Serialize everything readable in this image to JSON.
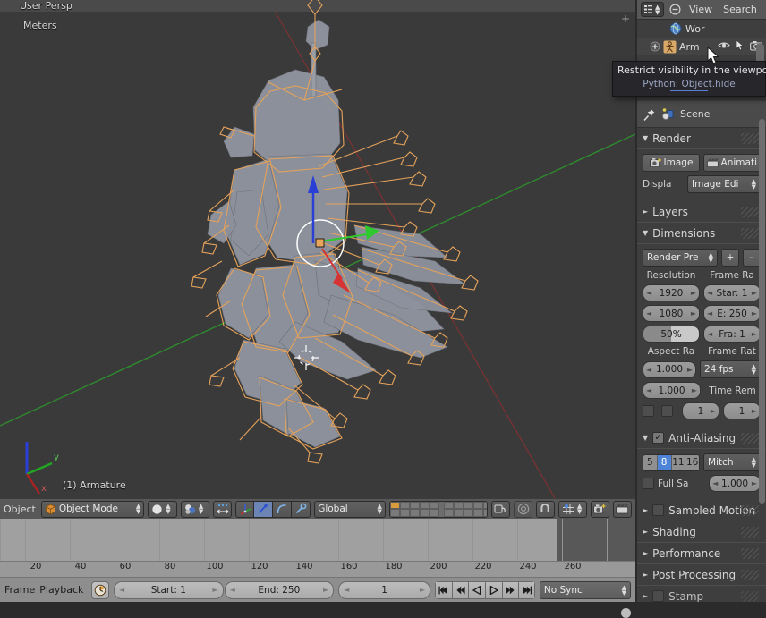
{
  "viewport": {
    "perspective_label": "User Persp",
    "units_label": "Meters",
    "object_label": "(1) Armature",
    "gizmo_axes": [
      "x",
      "y",
      "z"
    ]
  },
  "outliner": {
    "header": {
      "editor_type_icon": "outliner-icon",
      "display_mode_icon": "minus-circle-icon",
      "menus": [
        "View",
        "Search"
      ]
    },
    "rows": [
      {
        "label": "Wor",
        "icon": "world-globe-icon",
        "expander": ""
      },
      {
        "label": "Arm",
        "icon": "armature-icon",
        "expander": "+",
        "restrict_icons": [
          "eye-icon",
          "cursor-arrow-icon",
          "camera-icon"
        ]
      }
    ]
  },
  "tooltip": {
    "title": "Restrict visibility in the viewport",
    "python": "Python: Object.hide"
  },
  "properties": {
    "header": {
      "pin_icon": "pin-icon",
      "scene_icon": "scene-icon",
      "scene_label": "Scene"
    },
    "panels": [
      {
        "id": "render",
        "title": "Render",
        "expanded": true,
        "buttons": [
          {
            "label": "Image",
            "icon": "render-image-icon"
          },
          {
            "label": "Animati",
            "icon": "render-animation-icon"
          }
        ],
        "display_label": "Displa",
        "display_value": "Image Edi"
      },
      {
        "id": "layers",
        "title": "Layers",
        "expanded": false
      },
      {
        "id": "dimensions",
        "title": "Dimensions",
        "expanded": true,
        "preset_value": "Render Pre",
        "preset_add": "+",
        "preset_remove": "–",
        "resolution_header": "Resolution",
        "resolution_x": "1920",
        "resolution_y": "1080",
        "resolution_pct": "50%",
        "frame_range_header": "Frame Ra",
        "frame_start": "Star: 1",
        "frame_end": "E: 250",
        "frame_step": "Fra: 1",
        "aspect_header": "Aspect Ra",
        "aspect_x": "1.000",
        "aspect_y": "1.000",
        "framerate_header": "Frame Rat",
        "framerate_value": "24 fps",
        "time_remap_header": "Time Rem",
        "time_remap_old": "1",
        "time_remap_new": "1"
      },
      {
        "id": "anti-aliasing",
        "title": "Anti-Aliasing",
        "expanded": true,
        "checked": true,
        "samples": [
          "5",
          "8",
          "11",
          "16"
        ],
        "selected_sample": "8",
        "filter_value": "Mitch",
        "full_sample_label": "Full Sa",
        "full_sample_checked": false,
        "filter_size": "1.000"
      },
      {
        "id": "sampled-motion-blur",
        "title": "Sampled Motion",
        "expanded": false,
        "has_checkbox": true
      },
      {
        "id": "shading",
        "title": "Shading",
        "expanded": false
      },
      {
        "id": "performance",
        "title": "Performance",
        "expanded": false
      },
      {
        "id": "post-processing",
        "title": "Post Processing",
        "expanded": false
      },
      {
        "id": "stamp",
        "title": "Stamp",
        "expanded": false,
        "has_checkbox": true
      }
    ]
  },
  "viewport_toolbar": {
    "menu_label": "Object",
    "mode_value": "Object Mode",
    "mode_icon": "object-mode-cube-icon",
    "shading_icon": "solid-shading-sphere-icon",
    "render_engine_icon": "material-mode-icon",
    "expand_icon": "toggle-editmode-overlay-icon",
    "manipulator_icons": [
      "manipulator-toggle-icon",
      "translate-arrow-icon",
      "rotate-arc-icon",
      "scale-handle-icon"
    ],
    "transform_orientation": "Global",
    "layers_active_index": 0,
    "layer_count": 20,
    "proportional_edit_icon": "proportional-edit-icon",
    "proportional_falloff_icon": "smooth-falloff-icon",
    "snap_magnet_icon": "snap-magnet-icon",
    "snap_target_icon": "snap-increment-icon",
    "render_buttons": [
      "render-still-icon",
      "render-animation-icon"
    ]
  },
  "timeline": {
    "frame_label": "Frame",
    "playback_label": "Playback",
    "clock_icon": "playback-clock-icon",
    "start_label": "Start: 1",
    "end_label": "End: 250",
    "current_frame": "1",
    "transport_buttons": [
      "jump-to-start-icon",
      "jump-to-keyframe-prev-icon",
      "play-reverse-icon",
      "play-forward-icon",
      "jump-to-keyframe-next-icon",
      "jump-to-end-icon"
    ],
    "sync_value": "No Sync",
    "ruler_ticks": [
      "20",
      "40",
      "60",
      "80",
      "100",
      "120",
      "140",
      "160",
      "180",
      "200",
      "220",
      "240",
      "260"
    ],
    "range_end_frame": 250
  },
  "colors": {
    "accent_blue": "#4e84d8",
    "bone_orange": "#e8a55c",
    "axis_x_red": "#d83333",
    "axis_y_green": "#2ec92e",
    "axis_z_blue": "#2a3fd6",
    "panel_bg": "#3e3e3e",
    "header_bg": "#585858",
    "viewport_bg": "#3a3a3a"
  }
}
